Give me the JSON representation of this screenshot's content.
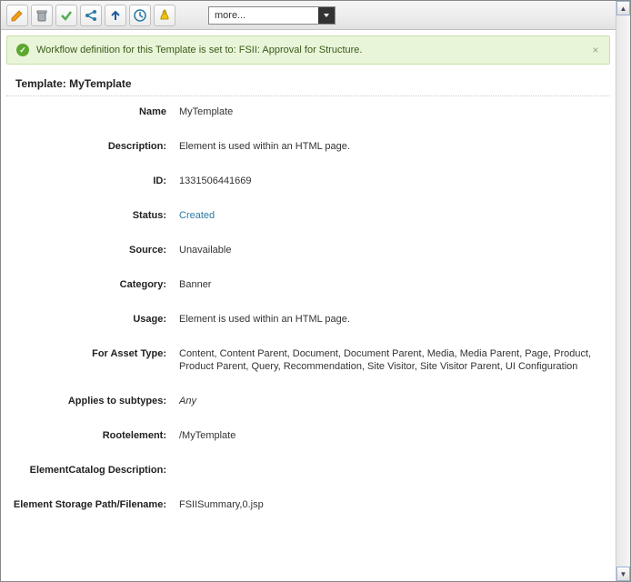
{
  "toolbar": {
    "more_label": "more..."
  },
  "notice": {
    "text": "Workflow definition for this Template is set to: FSII: Approval for Structure."
  },
  "heading": "Template: MyTemplate",
  "fields": {
    "name": {
      "label": "Name",
      "value": "MyTemplate"
    },
    "description": {
      "label": "Description:",
      "value": "Element is used within an HTML page."
    },
    "id": {
      "label": "ID:",
      "value": "1331506441669"
    },
    "status": {
      "label": "Status:",
      "value": "Created"
    },
    "source": {
      "label": "Source:",
      "value": "Unavailable"
    },
    "category": {
      "label": "Category:",
      "value": "Banner"
    },
    "usage": {
      "label": "Usage:",
      "value": "Element is used within an HTML page."
    },
    "assettype": {
      "label": "For Asset Type:",
      "value": "Content, Content Parent, Document, Document Parent, Media, Media Parent, Page, Product, Product Parent, Query, Recommendation, Site Visitor, Site Visitor Parent, UI Configuration"
    },
    "subtypes": {
      "label": "Applies to subtypes:",
      "value": "Any"
    },
    "rootelement": {
      "label": "Rootelement:",
      "value": "/MyTemplate"
    },
    "catalogdesc": {
      "label": "ElementCatalog Description:",
      "value": ""
    },
    "storagepath": {
      "label": "Element Storage Path/Filename:",
      "value": "FSIISummary,0.jsp"
    }
  }
}
